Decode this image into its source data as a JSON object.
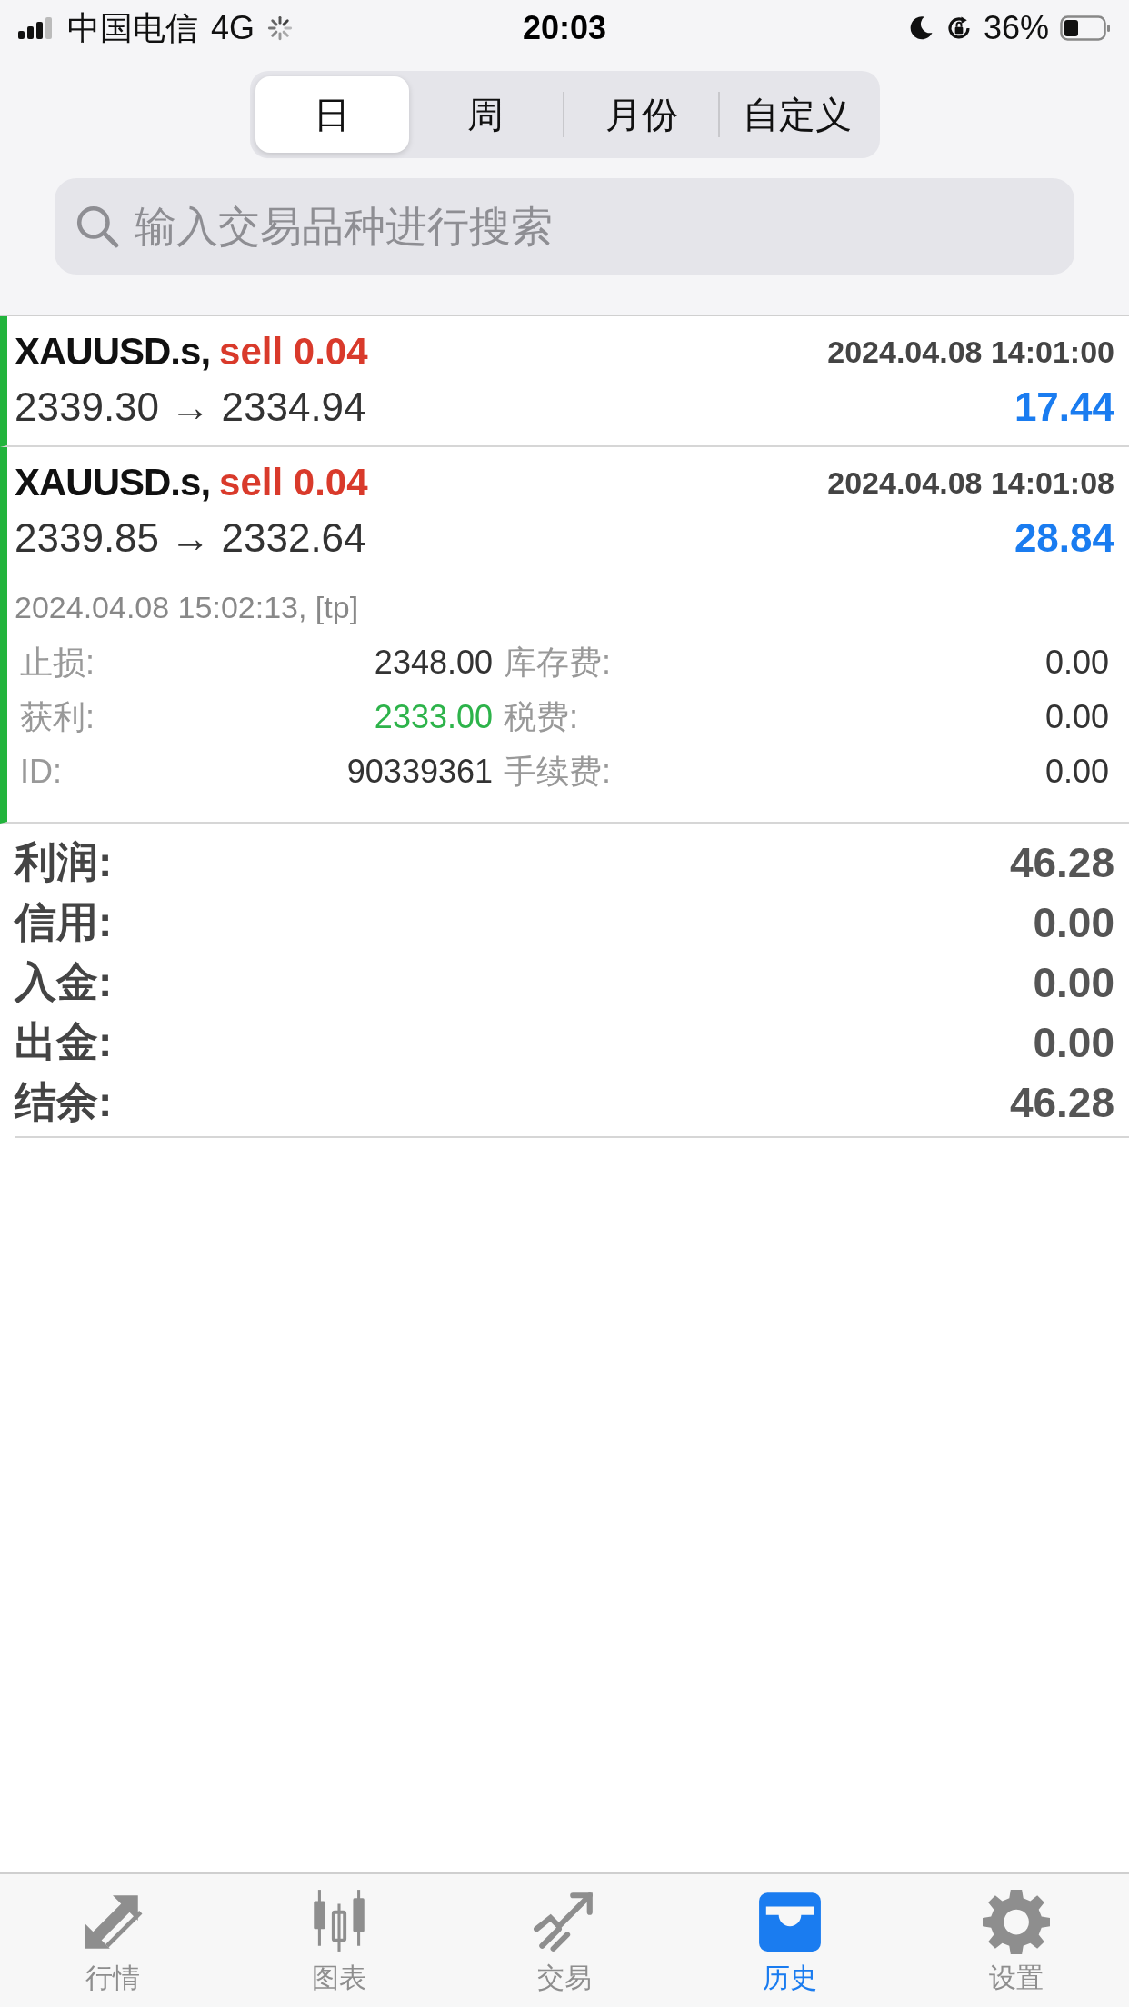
{
  "status_bar": {
    "carrier": "中国电信",
    "network": "4G",
    "time": "20:03",
    "battery": "36%"
  },
  "period_tabs": [
    {
      "label": "日",
      "selected": true
    },
    {
      "label": "周",
      "selected": false
    },
    {
      "label": "月份",
      "selected": false
    },
    {
      "label": "自定义",
      "selected": false
    }
  ],
  "search": {
    "placeholder": "输入交易品种进行搜索"
  },
  "deals": [
    {
      "symbol": "XAUUSD.s,",
      "side": "sell 0.04",
      "time": "2024.04.08 14:01:00",
      "prices": "2339.30 → 2334.94",
      "profit": "17.44",
      "expanded": false
    },
    {
      "symbol": "XAUUSD.s,",
      "side": "sell 0.04",
      "time": "2024.04.08 14:01:08",
      "prices": "2339.85 → 2332.64",
      "profit": "28.84",
      "expanded": true,
      "close_info": "2024.04.08 15:02:13, [tp]",
      "details": [
        {
          "label": "止损:",
          "value": "2348.00",
          "highlight": false
        },
        {
          "label": "库存费:",
          "value": "0.00",
          "highlight": false
        },
        {
          "label": "获利:",
          "value": "2333.00",
          "highlight": true
        },
        {
          "label": "税费:",
          "value": "0.00",
          "highlight": false
        },
        {
          "label": "ID:",
          "value": "90339361",
          "highlight": false
        },
        {
          "label": "手续费:",
          "value": "0.00",
          "highlight": false
        }
      ]
    }
  ],
  "summary": [
    {
      "label": "利润:",
      "value": "46.28"
    },
    {
      "label": "信用:",
      "value": "0.00"
    },
    {
      "label": "入金:",
      "value": "0.00"
    },
    {
      "label": "出金:",
      "value": "0.00"
    },
    {
      "label": "结余:",
      "value": "46.28"
    }
  ],
  "tab_bar": [
    {
      "label": "行情",
      "kind": "arrows",
      "selected": false
    },
    {
      "label": "图表",
      "kind": "candles",
      "selected": false
    },
    {
      "label": "交易",
      "kind": "trend",
      "selected": false
    },
    {
      "label": "历史",
      "kind": "inbox",
      "selected": true
    },
    {
      "label": "设置",
      "kind": "gear",
      "selected": false
    }
  ]
}
